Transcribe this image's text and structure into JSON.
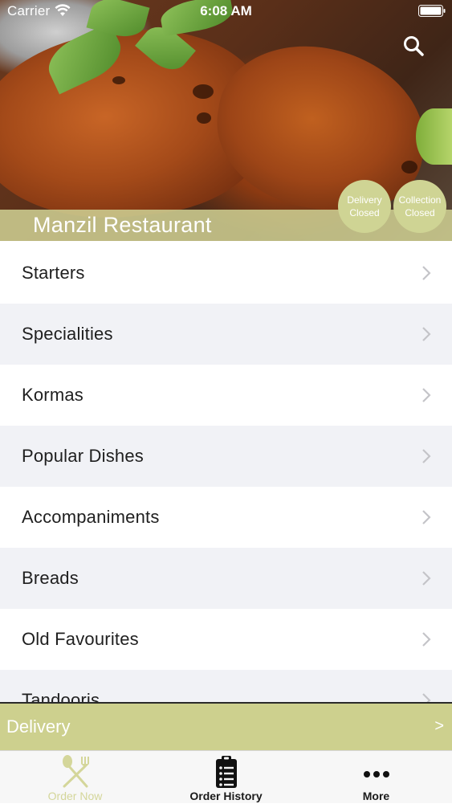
{
  "status_bar": {
    "carrier": "Carrier",
    "time": "6:08 AM"
  },
  "header": {
    "restaurant_name": "Manzil Restaurant",
    "delivery_status": {
      "line1": "Delivery",
      "line2": "Closed"
    },
    "collection_status": {
      "line1": "Collection",
      "line2": "Closed"
    },
    "search_icon": "search-icon"
  },
  "menu": {
    "items": [
      {
        "label": "Starters"
      },
      {
        "label": "Specialities"
      },
      {
        "label": "Kormas"
      },
      {
        "label": "Popular Dishes"
      },
      {
        "label": "Accompaniments"
      },
      {
        "label": "Breads"
      },
      {
        "label": "Old Favourites"
      },
      {
        "label": "Tandooris"
      }
    ]
  },
  "delivery_bar": {
    "label": "Delivery",
    "arrow": ">"
  },
  "tab_bar": {
    "tabs": [
      {
        "label": "Order Now",
        "icon": "utensils-icon",
        "active": true
      },
      {
        "label": "Order History",
        "icon": "clipboard-list-icon",
        "active": false
      },
      {
        "label": "More",
        "icon": "more-dots-icon",
        "active": false
      }
    ]
  },
  "colors": {
    "accent": "#cdd08e",
    "active_tab": "#d4d69a",
    "row_alt": "#f1f2f6"
  }
}
